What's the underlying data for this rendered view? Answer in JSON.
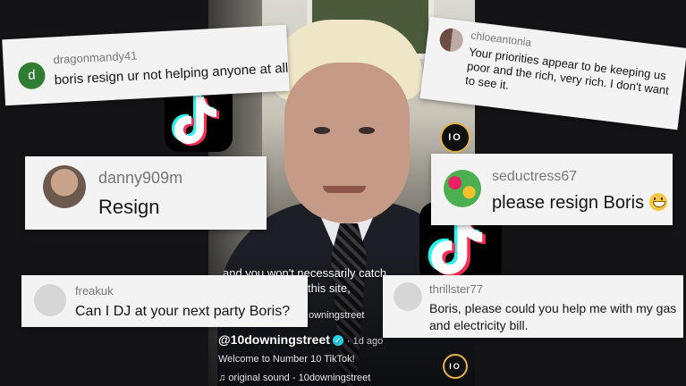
{
  "video": {
    "subtitle_line1": "and you won't necessarily catch",
    "subtitle_line2": "this site,",
    "cropped_handle": "owningstreet",
    "handle": "@10downingstreet",
    "verified_icon": "verified-check-icon",
    "time_ago": "· 1d ago",
    "description": "Welcome to Number 10 TikTok!",
    "sound": "original sound - 10downingstreet",
    "badge_text": "IO"
  },
  "comments": [
    {
      "user": "dragonmandy41",
      "avatar_letter": "d",
      "avatar_color": "#2e7d32",
      "text": "boris resign ur not helping anyone at all"
    },
    {
      "user": "chloeantonia",
      "avatar_color": "#8d6e63",
      "text": "Your priorities appear to be keeping us poor and the rich, very rich. I don't want to see it."
    },
    {
      "user": "danny909m",
      "avatar_color": "#a1887f",
      "text": "Resign"
    },
    {
      "user": "seductress67",
      "avatar_color": "#d81b60",
      "text": "please resign Boris",
      "emoji": "grinning-face-emoji"
    },
    {
      "user": "freakuk",
      "avatar_color": "#cfcfcf",
      "text": "Can I DJ at your next party Boris?"
    },
    {
      "user": "thrillster77",
      "avatar_color": "#cfcfcf",
      "text": "Boris, please could you help me with my gas and electricity bill."
    }
  ],
  "icons": {
    "tiktok": "tiktok-logo-icon",
    "music": "music-note-icon"
  },
  "colors": {
    "tiktok_cyan": "#25f4ee",
    "tiktok_red": "#fe2c55",
    "background": "#141416",
    "card": "#f3f3f3"
  }
}
